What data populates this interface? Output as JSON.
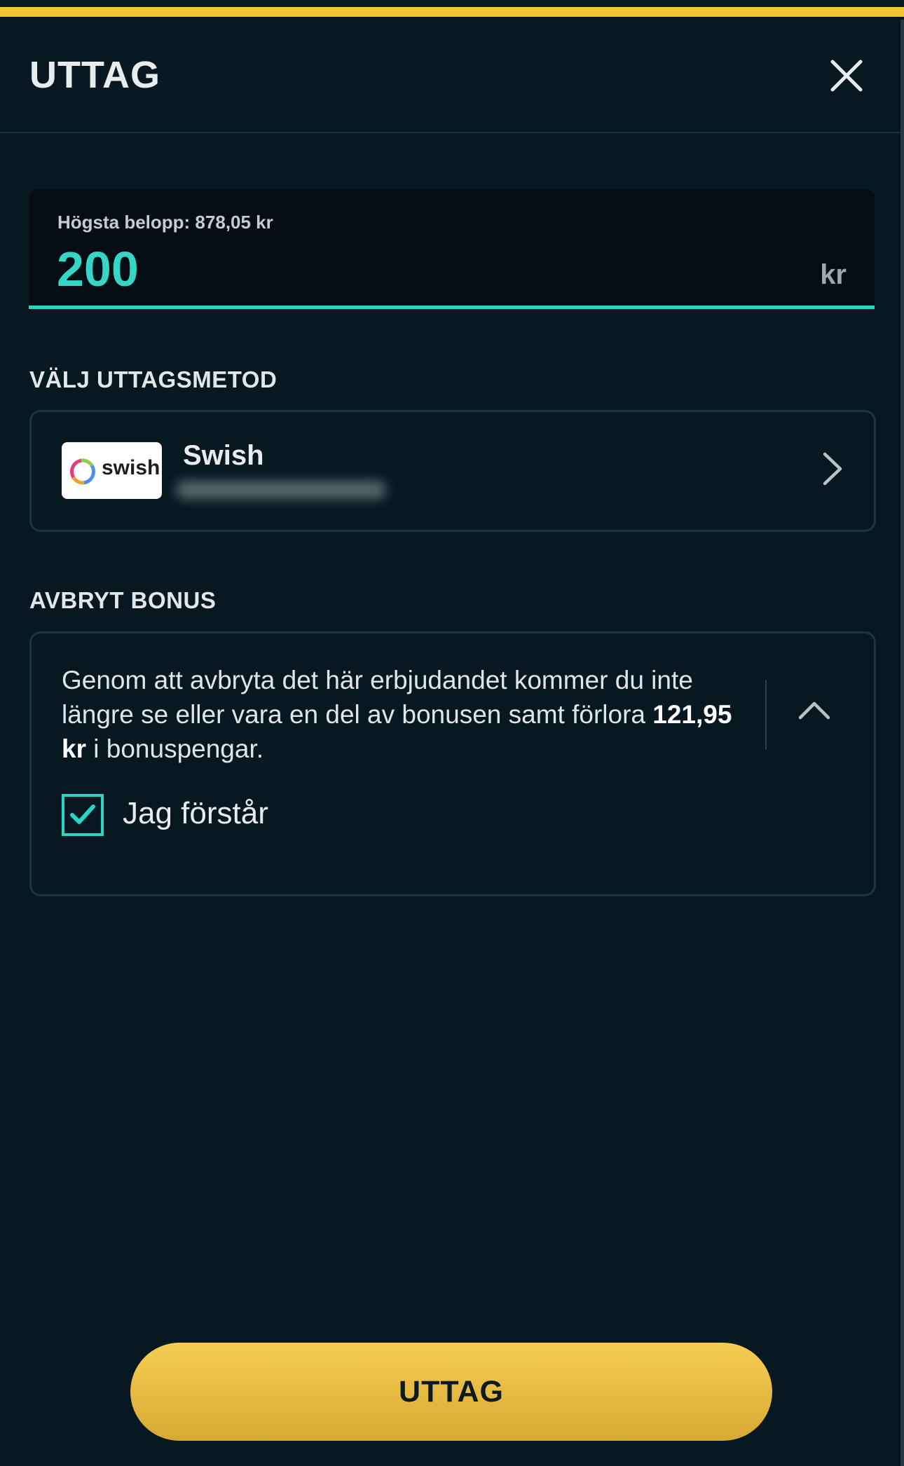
{
  "header": {
    "title": "UTTAG"
  },
  "amount": {
    "hint": "Högsta belopp: 878,05 kr",
    "value": "200",
    "unit": "kr"
  },
  "method_section": {
    "label": "VÄLJ UTTAGSMETOD",
    "method_name": "Swish",
    "logo_text": "swish"
  },
  "bonus_section": {
    "label": "AVBRYT BONUS",
    "text_before": "Genom att avbryta det här erbjudandet kommer du inte längre se eller vara en del av bonusen samt förlora ",
    "amount": "121,95 kr",
    "text_after": " i bonuspengar.",
    "checkbox_label": "Jag förstår",
    "checked": true
  },
  "footer": {
    "button_label": "UTTAG"
  },
  "colors": {
    "accent_teal": "#2ad4c2",
    "button_yellow": "#f3c531",
    "background": "#071820"
  },
  "icons": [
    "close-icon",
    "chevron-right-icon",
    "chevron-up-icon",
    "checkmark-icon",
    "swish-logo-icon"
  ]
}
